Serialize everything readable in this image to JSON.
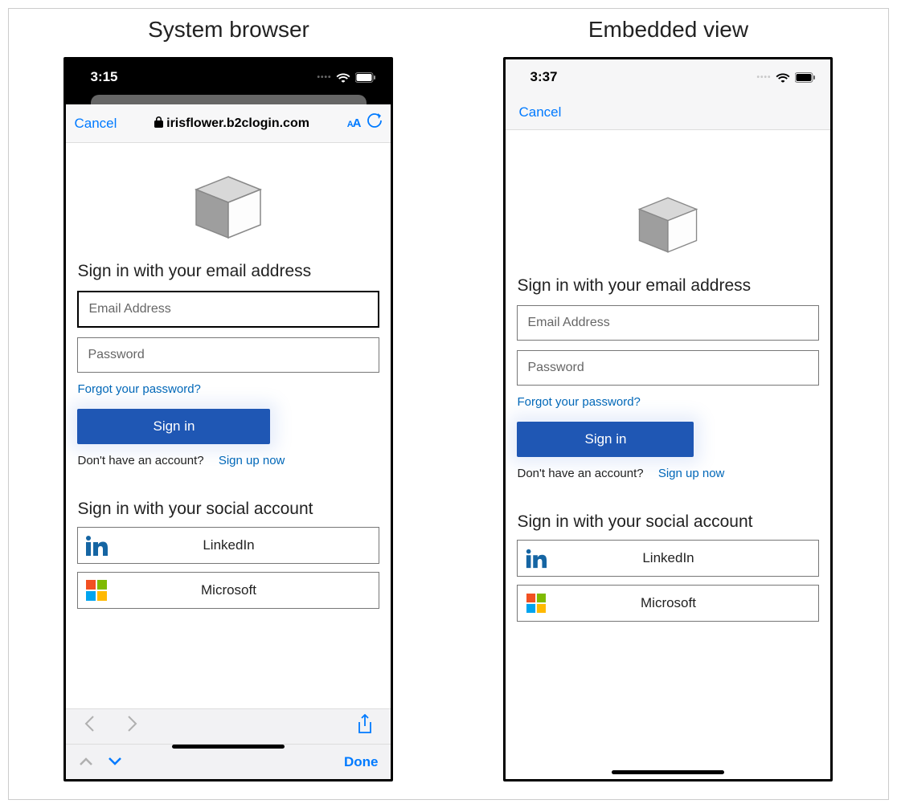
{
  "labels": {
    "system_title": "System browser",
    "embedded_title": "Embedded view"
  },
  "system": {
    "status_time": "3:15",
    "cancel": "Cancel",
    "url_domain": "irisflower.b2clogin.com",
    "text_size": "AA",
    "done": "Done"
  },
  "embedded": {
    "status_time": "3:37",
    "cancel": "Cancel"
  },
  "signin": {
    "headline": "Sign in with your email address",
    "email_placeholder": "Email Address",
    "password_placeholder": "Password",
    "forgot": "Forgot your password?",
    "button": "Sign in",
    "no_account": "Don't have an account?",
    "signup": "Sign up now",
    "social_headline": "Sign in with your social account",
    "providers": {
      "linkedin": "LinkedIn",
      "microsoft": "Microsoft"
    }
  }
}
